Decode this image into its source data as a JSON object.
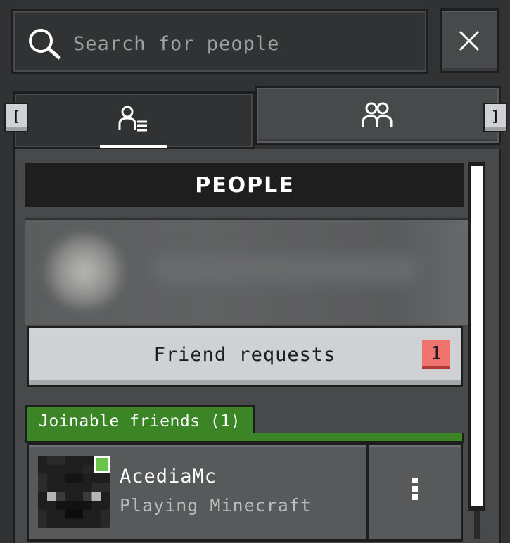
{
  "search": {
    "placeholder": "Search for people"
  },
  "tabs": [
    {
      "icon": "person-list-icon",
      "selected": true
    },
    {
      "icon": "people-group-icon",
      "selected": false
    }
  ],
  "keybinds": {
    "prev_tab": "[",
    "next_tab": "]"
  },
  "section_header": "PEOPLE",
  "friend_requests": {
    "label": "Friend requests",
    "count": "1"
  },
  "joinable_friends": {
    "label": "Joinable friends (1)",
    "items": [
      {
        "name": "AcediaMc",
        "status": "Playing Minecraft",
        "online": true
      }
    ]
  },
  "colors": {
    "background": "#313233",
    "panel": "#48494a",
    "accent_green": "#3c8527",
    "badge": "#f0736f",
    "online": "#6cc349"
  }
}
